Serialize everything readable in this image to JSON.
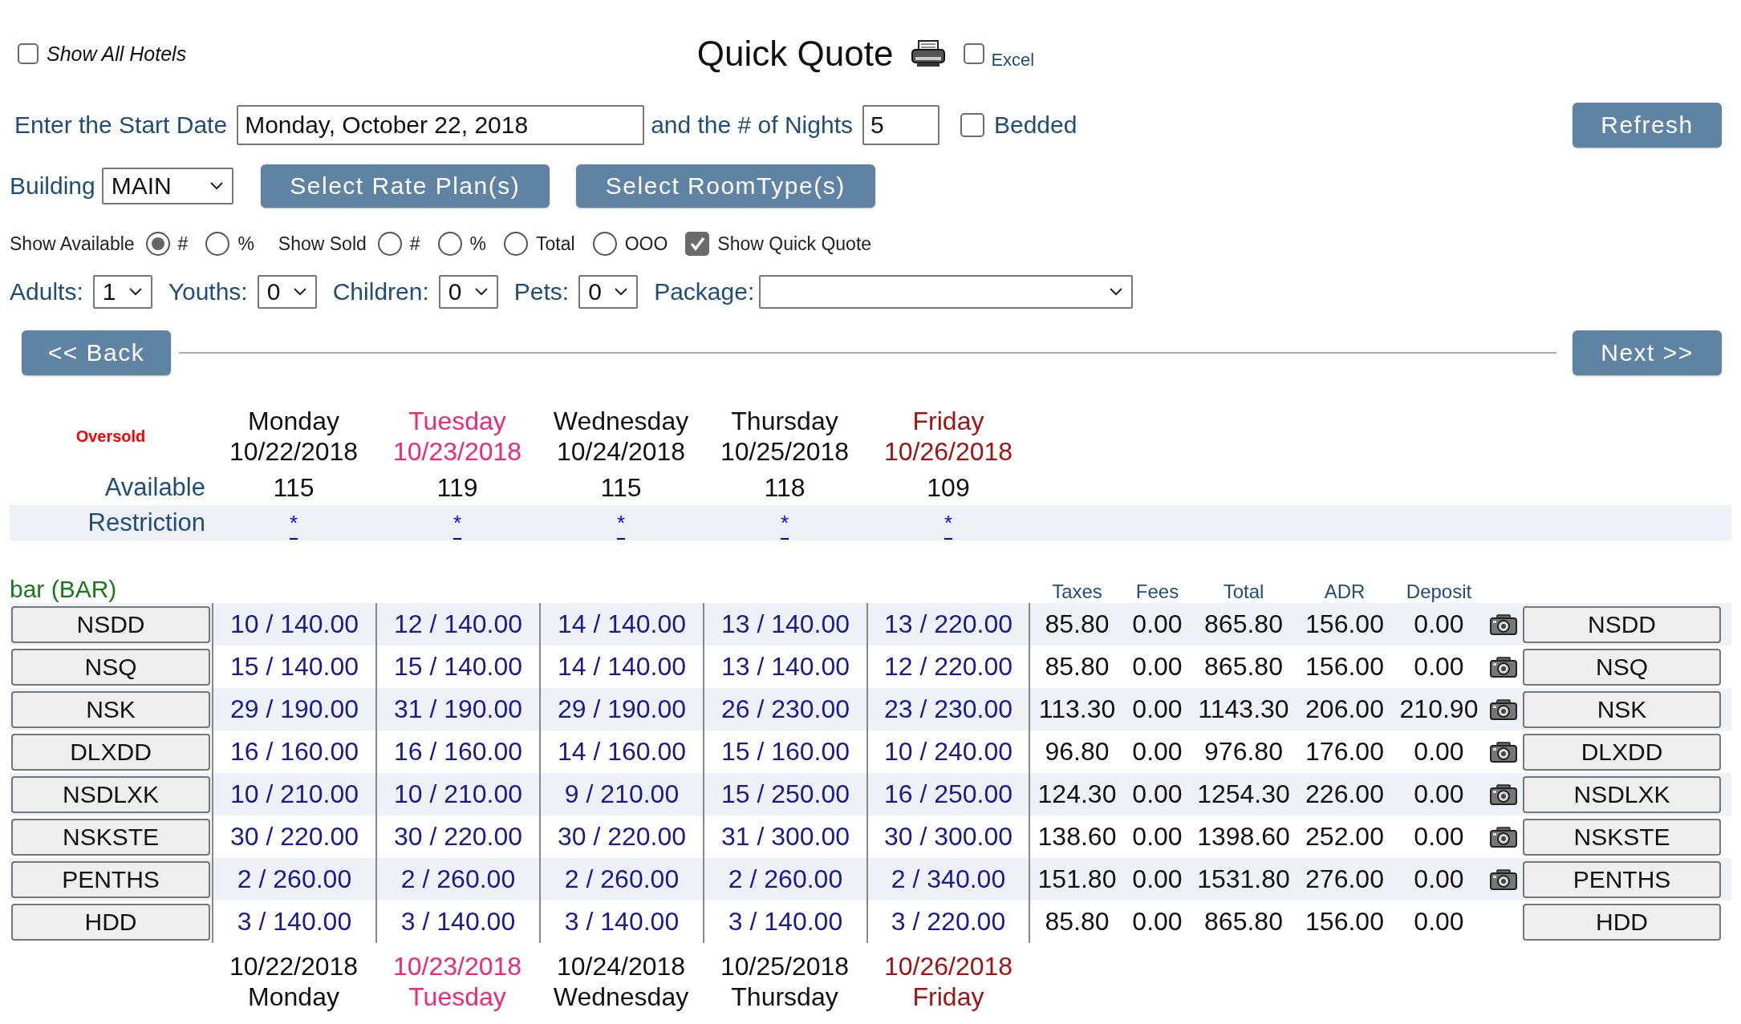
{
  "show_all_hotels": {
    "label": "Show All Hotels",
    "checked": false
  },
  "title": "Quick Quote",
  "excel": {
    "label": "Excel",
    "checked": false
  },
  "start_date": {
    "label": "Enter the Start Date",
    "value": "Monday, October 22, 2018"
  },
  "nights": {
    "label": "and the # of Nights",
    "value": "5"
  },
  "bedded": {
    "label": "Bedded",
    "checked": false
  },
  "refresh_button": "Refresh",
  "building": {
    "label": "Building",
    "value": "MAIN"
  },
  "select_buttons": [
    "Select Rate Plan(s)",
    "Select RoomType(s)"
  ],
  "display_options": [
    {
      "kind": "text",
      "label": "Show Available"
    },
    {
      "kind": "radio",
      "label": "#",
      "selected": true
    },
    {
      "kind": "radio",
      "label": "%",
      "selected": false
    },
    {
      "kind": "text",
      "label": "Show Sold"
    },
    {
      "kind": "radio",
      "label": "#",
      "selected": false
    },
    {
      "kind": "radio",
      "label": "%",
      "selected": false
    },
    {
      "kind": "radio",
      "label": "Total",
      "selected": false
    },
    {
      "kind": "radio",
      "label": "OOO",
      "selected": false
    },
    {
      "kind": "checkbox",
      "label": "Show Quick Quote",
      "checked": true
    }
  ],
  "guests": [
    {
      "label": "Adults:",
      "value": "1"
    },
    {
      "label": "Youths:",
      "value": "0"
    },
    {
      "label": "Children:",
      "value": "0"
    },
    {
      "label": "Pets:",
      "value": "0"
    }
  ],
  "package": {
    "label": "Package:"
  },
  "back_button": "<< Back",
  "next_button": "Next >>",
  "oversold_label": "Oversold",
  "days": [
    {
      "weekday": "Monday",
      "date": "10/22/2018",
      "color": "#111111"
    },
    {
      "weekday": "Tuesday",
      "date": "10/23/2018",
      "color": "#f0287a"
    },
    {
      "weekday": "Wednesday",
      "date": "10/24/2018",
      "color": "#111111"
    },
    {
      "weekday": "Thursday",
      "date": "10/25/2018",
      "color": "#111111"
    },
    {
      "weekday": "Friday",
      "date": "10/26/2018",
      "color": "#a01414"
    }
  ],
  "available": {
    "label": "Available",
    "values": [
      "115",
      "119",
      "115",
      "118",
      "109"
    ]
  },
  "restriction": {
    "label": "Restriction",
    "values": [
      "*",
      "*",
      "*",
      "*",
      "*"
    ]
  },
  "rate_plan": "bar (BAR)",
  "columns": [
    "Taxes",
    "Fees",
    "Total",
    "ADR",
    "Deposit"
  ],
  "rows": [
    {
      "room_type": "NSDD",
      "nights": [
        "10 / 140.00",
        "12 / 140.00",
        "14 / 140.00",
        "13 / 140.00",
        "13 / 220.00"
      ],
      "taxes": "85.80",
      "fees": "0.00",
      "total": "865.80",
      "adr": "156.00",
      "deposit": "0.00",
      "photo": true,
      "room_type_end": "NSDD"
    },
    {
      "room_type": "NSQ",
      "nights": [
        "15 / 140.00",
        "15 / 140.00",
        "14 / 140.00",
        "13 / 140.00",
        "12 / 220.00"
      ],
      "taxes": "85.80",
      "fees": "0.00",
      "total": "865.80",
      "adr": "156.00",
      "deposit": "0.00",
      "photo": true,
      "room_type_end": "NSQ"
    },
    {
      "room_type": "NSK",
      "nights": [
        "29 / 190.00",
        "31 / 190.00",
        "29 / 190.00",
        "26 / 230.00",
        "23 / 230.00"
      ],
      "taxes": "113.30",
      "fees": "0.00",
      "total": "1143.30",
      "adr": "206.00",
      "deposit": "210.90",
      "photo": true,
      "room_type_end": "NSK"
    },
    {
      "room_type": "DLXDD",
      "nights": [
        "16 / 160.00",
        "16 / 160.00",
        "14 / 160.00",
        "15 / 160.00",
        "10 / 240.00"
      ],
      "taxes": "96.80",
      "fees": "0.00",
      "total": "976.80",
      "adr": "176.00",
      "deposit": "0.00",
      "photo": true,
      "room_type_end": "DLXDD"
    },
    {
      "room_type": "NSDLXK",
      "nights": [
        "10 / 210.00",
        "10 / 210.00",
        "9 / 210.00",
        "15 / 250.00",
        "16 / 250.00"
      ],
      "taxes": "124.30",
      "fees": "0.00",
      "total": "1254.30",
      "adr": "226.00",
      "deposit": "0.00",
      "photo": true,
      "room_type_end": "NSDLXK"
    },
    {
      "room_type": "NSKSTE",
      "nights": [
        "30 / 220.00",
        "30 / 220.00",
        "30 / 220.00",
        "31 / 300.00",
        "30 / 300.00"
      ],
      "taxes": "138.60",
      "fees": "0.00",
      "total": "1398.60",
      "adr": "252.00",
      "deposit": "0.00",
      "photo": true,
      "room_type_end": "NSKSTE"
    },
    {
      "room_type": "PENTHS",
      "nights": [
        "2 / 260.00",
        "2 / 260.00",
        "2 / 260.00",
        "2 / 260.00",
        "2 / 340.00"
      ],
      "taxes": "151.80",
      "fees": "0.00",
      "total": "1531.80",
      "adr": "276.00",
      "deposit": "0.00",
      "photo": true,
      "room_type_end": "PENTHS"
    },
    {
      "room_type": "HDD",
      "nights": [
        "3 / 140.00",
        "3 / 140.00",
        "3 / 140.00",
        "3 / 140.00",
        "3 / 220.00"
      ],
      "taxes": "85.80",
      "fees": "0.00",
      "total": "865.80",
      "adr": "156.00",
      "deposit": "0.00",
      "photo": false,
      "room_type_end": "HDD"
    }
  ],
  "footer_days": [
    {
      "date": "10/22/2018",
      "weekday": "Monday",
      "color": "#111111"
    },
    {
      "date": "10/23/2018",
      "weekday": "Tuesday",
      "color": "#f0287a"
    },
    {
      "date": "10/24/2018",
      "weekday": "Wednesday",
      "color": "#111111"
    },
    {
      "date": "10/25/2018",
      "weekday": "Thursday",
      "color": "#111111"
    },
    {
      "date": "10/26/2018",
      "weekday": "Friday",
      "color": "#a01414"
    }
  ]
}
